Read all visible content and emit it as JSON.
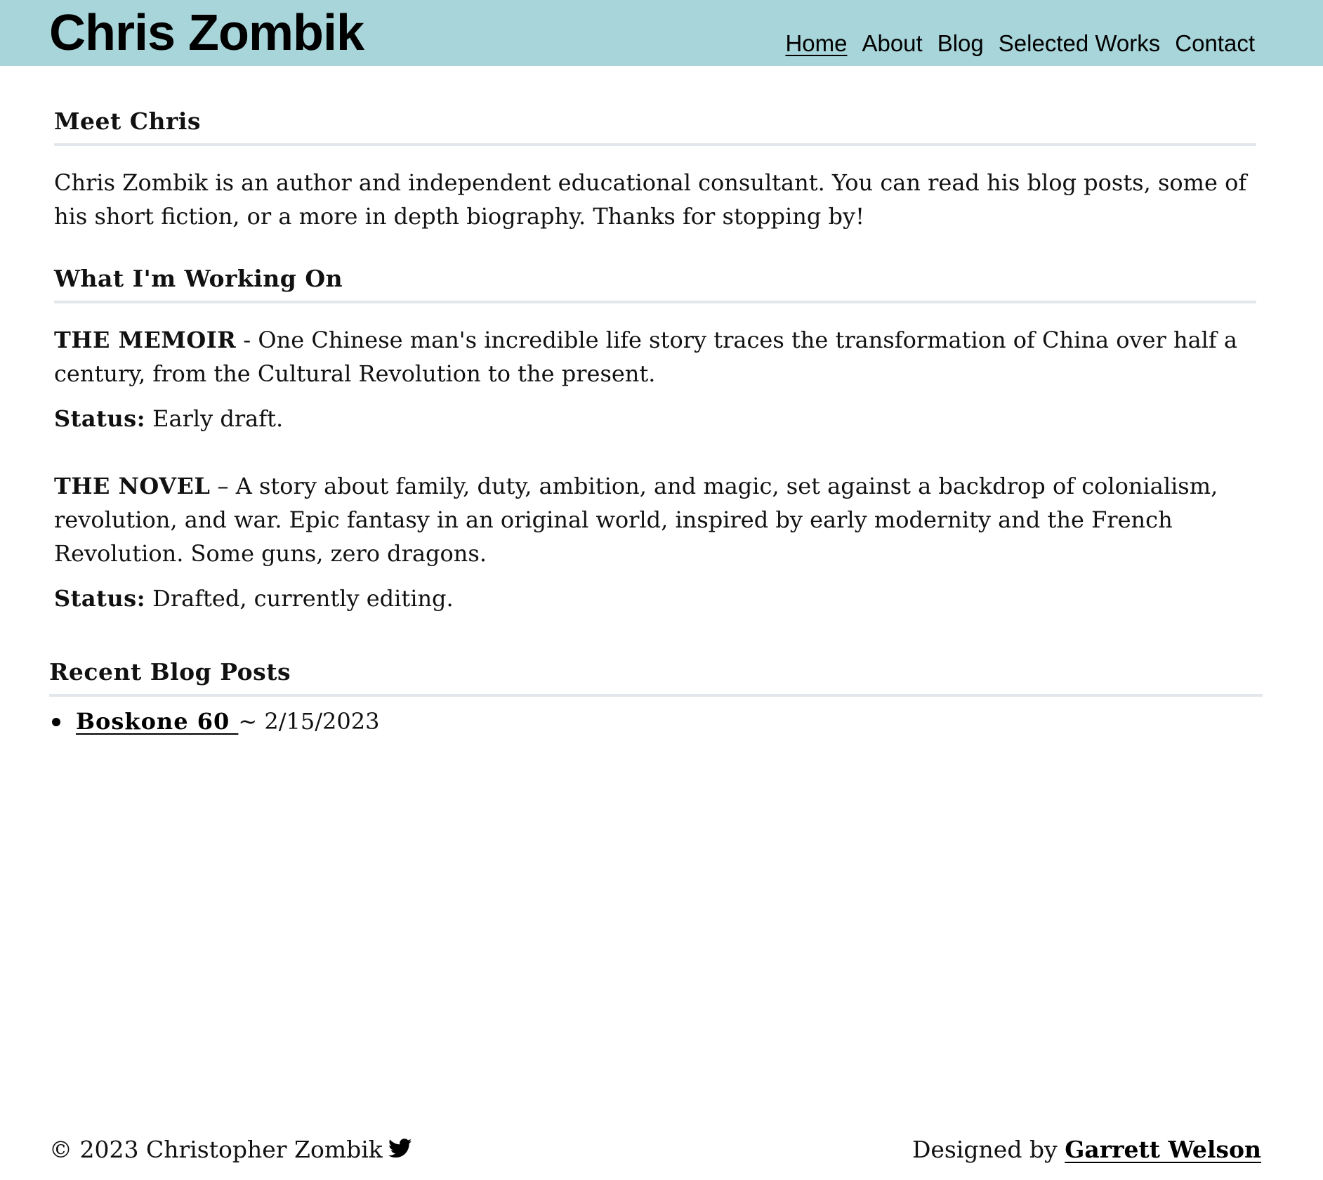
{
  "header": {
    "site_title": "Chris Zombik",
    "nav": [
      {
        "label": "Home",
        "active": true
      },
      {
        "label": "About",
        "active": false
      },
      {
        "label": "Blog",
        "active": false
      },
      {
        "label": "Selected Works",
        "active": false
      },
      {
        "label": "Contact",
        "active": false
      }
    ],
    "background_color": "#a8d5da"
  },
  "meet": {
    "heading": "Meet Chris",
    "body": "Chris Zombik is an author and independent educational consultant. You can read his blog posts, some of his short fiction, or a more in depth biography. Thanks for stopping by!"
  },
  "working": {
    "heading": "What I'm Working On",
    "projects": [
      {
        "title": "THE MEMOIR",
        "description": " - One Chinese man's incredible life story traces the transformation of China over half a century, from the Cultural Revolution to the present.",
        "status_label": "Status:",
        "status_value": " Early draft."
      },
      {
        "title": "THE NOVEL",
        "description": " – A story about family, duty, ambition, and magic, set against a backdrop of colonialism, revolution, and war. Epic fantasy in an original world, inspired by early modernity and the French Revolution. Some guns, zero dragons.",
        "status_label": "Status:",
        "status_value": " Drafted, currently editing."
      }
    ]
  },
  "recent_posts": {
    "heading": "Recent Blog Posts",
    "posts": [
      {
        "title": "Boskone 60 ",
        "date": " ~ 2/15/2023"
      }
    ]
  },
  "footer": {
    "copyright": "© 2023 Christopher Zombik",
    "social_icon": "twitter-icon",
    "designed_by_prefix": "Designed by ",
    "designer": "Garrett Welson"
  }
}
